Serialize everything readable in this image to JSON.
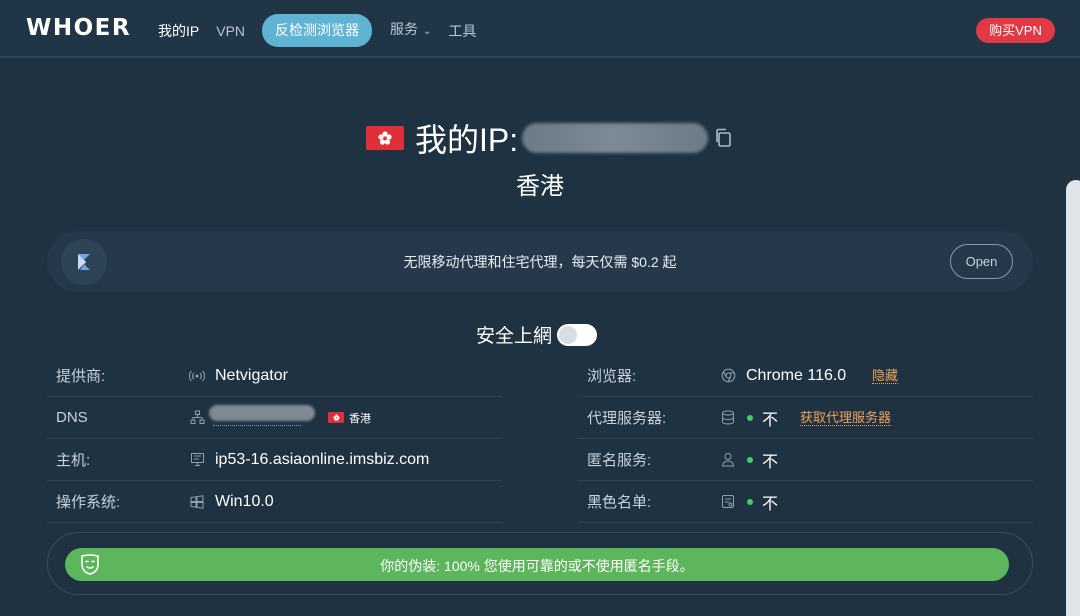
{
  "header": {
    "logo": "WHOER",
    "nav": [
      {
        "label": "我的IP"
      },
      {
        "label": "VPN"
      },
      {
        "label": "反检测浏览器"
      },
      {
        "label": "服务"
      },
      {
        "label": "工具"
      }
    ],
    "buy_label": "购买VPN"
  },
  "hero": {
    "title": "我的IP:",
    "country": "香港",
    "flag_icon": "hong-kong-flag-icon",
    "copy_icon": "copy-icon"
  },
  "banner": {
    "text": "无限移动代理和住宅代理，每天仅需 $0.2 起",
    "open_label": "Open"
  },
  "safe": {
    "label": "安全上網",
    "enabled": false
  },
  "info_left": [
    {
      "label": "提供商:",
      "icon": "broadcast-icon",
      "value": "Netvigator"
    },
    {
      "label": "DNS",
      "icon": "network-icon",
      "value": "",
      "country": "香港"
    },
    {
      "label": "主机:",
      "icon": "server-icon",
      "value": "ip53-16.asiaonline.imsbiz.com"
    },
    {
      "label": "操作系统:",
      "icon": "windows-icon",
      "value": "Win10.0"
    }
  ],
  "info_right": [
    {
      "label": "浏览器:",
      "icon": "chrome-icon",
      "value": "Chrome 116.0",
      "link": "隐藏"
    },
    {
      "label": "代理服务器:",
      "icon": "database-icon",
      "value": "不",
      "link": "获取代理服务器"
    },
    {
      "label": "匿名服务:",
      "icon": "user-icon",
      "value": "不"
    },
    {
      "label": "黑色名单:",
      "icon": "blacklist-icon",
      "value": "不"
    }
  ],
  "disguise": {
    "text": "你的伪装: 100% 您使用可靠的或不使用匿名手段。",
    "percent": 100,
    "icon": "mask-icon"
  },
  "colors": {
    "background": "#1e3242",
    "accent": "#5fb3d3",
    "buy": "#e23a44",
    "success": "#5db55c",
    "link": "#f0a35c"
  }
}
